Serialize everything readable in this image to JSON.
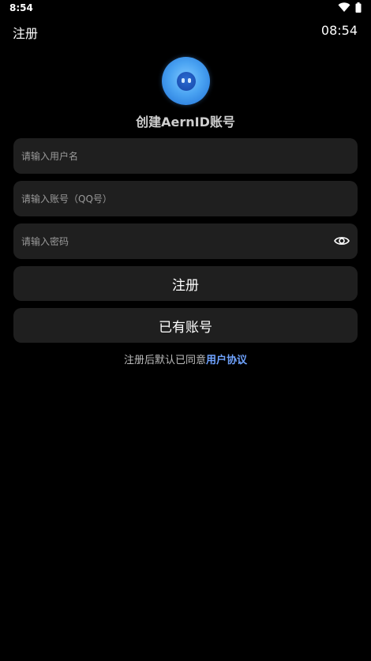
{
  "status_bar": {
    "time": "8:54",
    "icons": [
      "wifi-icon",
      "battery-icon"
    ]
  },
  "header": {
    "title": "注册",
    "time": "08:54"
  },
  "logo": {
    "icon": "aern-logo-icon",
    "colors": {
      "outer": "#4aa3f2",
      "inner": "#1546a8"
    }
  },
  "heading": "创建AernID账号",
  "form": {
    "username": {
      "placeholder": "请输入用户名",
      "value": ""
    },
    "qq_account": {
      "placeholder": "请输入账号（QQ号）",
      "value": ""
    },
    "password": {
      "placeholder": "请输入密码",
      "value": "",
      "toggle_icon": "eye-icon"
    }
  },
  "buttons": {
    "register": "注册",
    "have_account": "已有账号"
  },
  "agreement": {
    "prefix": "注册后默认已同意",
    "link": "用户协议"
  },
  "colors": {
    "background": "#000000",
    "surface": "#1f1f1f",
    "link": "#6fa3ff"
  }
}
